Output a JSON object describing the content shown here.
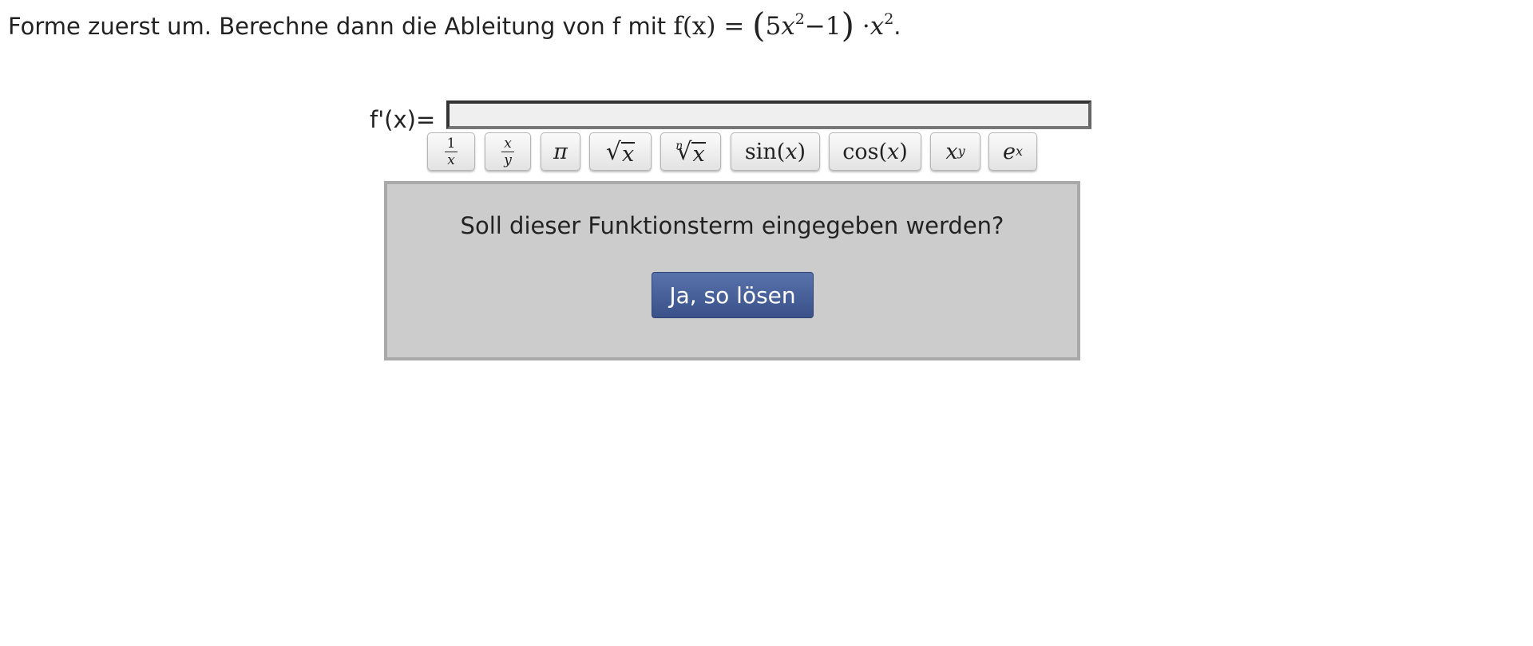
{
  "task": {
    "intro": "Forme zuerst um. Berechne dann die Ableitung von f mit ",
    "formula_lhs": "f(x) = ",
    "formula_open": "(",
    "formula_coeff": "5",
    "formula_var": "x",
    "formula_exp": "2",
    "formula_minus": "−",
    "formula_const": "1",
    "formula_close": ")",
    "formula_dot": " ·",
    "formula_var2": "x",
    "formula_exp2": "2",
    "end": "."
  },
  "answer": {
    "label": "f'(x)=",
    "value": ""
  },
  "keyboard": {
    "reciprocal": {
      "num": "1",
      "den": "x"
    },
    "fraction": {
      "num": "x",
      "den": "y"
    },
    "pi": "π",
    "sqrt": {
      "sign": "√",
      "radicand": "x"
    },
    "nthroot": {
      "index": "n",
      "sign": "√",
      "radicand": "x"
    },
    "sin": {
      "fn": "sin(",
      "arg": "x",
      "close": ")"
    },
    "cos": {
      "fn": "cos(",
      "arg": "x",
      "close": ")"
    },
    "power": {
      "base": "x",
      "exp": "y"
    },
    "exp": {
      "base": "e",
      "exp": "x"
    }
  },
  "confirm": {
    "question": "Soll dieser Funktionsterm eingegeben werden?",
    "button_label": "Ja, so lösen"
  }
}
